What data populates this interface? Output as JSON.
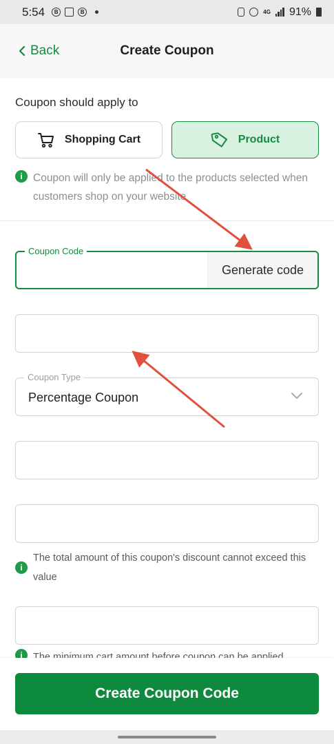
{
  "status_bar": {
    "time": "5:54",
    "battery_percent": "91%",
    "network": "4G"
  },
  "header": {
    "back_label": "Back",
    "title": "Create Coupon"
  },
  "apply_section": {
    "label": "Coupon should apply to",
    "options": [
      {
        "label": "Shopping Cart",
        "icon": "cart-icon",
        "selected": false
      },
      {
        "label": "Product",
        "icon": "tag-icon",
        "selected": true
      }
    ],
    "info": "Coupon will only be applied to the products selected when customers shop on your website"
  },
  "form": {
    "coupon_code": {
      "label": "Coupon Code",
      "value": "",
      "generate_label": "Generate code"
    },
    "coupon_name": {
      "value": ""
    },
    "coupon_type": {
      "label": "Coupon Type",
      "value": "Percentage Coupon"
    },
    "coupon_value": {
      "value": ""
    },
    "max_discount": {
      "value": "",
      "info": "The total amount of this coupon's discount cannot exceed this value"
    },
    "min_cart": {
      "value": "",
      "info": "The minimum cart amount before coupon can be applied"
    }
  },
  "footer": {
    "create_label": "Create Coupon Code"
  },
  "colors": {
    "accent": "#168a3e",
    "accent_bg": "#d9f1e1",
    "primary_button": "#0e8a3e",
    "annotation_arrow": "#e0503c"
  }
}
